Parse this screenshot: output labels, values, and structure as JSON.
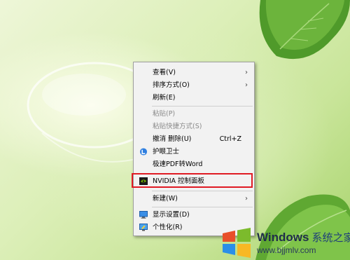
{
  "context_menu": {
    "view": {
      "label": "查看(V)"
    },
    "sort": {
      "label": "排序方式(O)"
    },
    "refresh": {
      "label": "刷新(E)"
    },
    "paste": {
      "label": "粘贴(P)"
    },
    "paste_shortcut": {
      "label": "粘贴快捷方式(S)"
    },
    "undo_delete": {
      "label": "撤消 删除(U)",
      "shortcut": "Ctrl+Z"
    },
    "eye_guard": {
      "label": "护眼卫士"
    },
    "pdf_to_word": {
      "label": "极速PDF转Word"
    },
    "nvidia": {
      "label": "NVIDIA 控制面板"
    },
    "new": {
      "label": "新建(W)"
    },
    "display": {
      "label": "显示设置(D)"
    },
    "personalize": {
      "label": "个性化(R)"
    }
  },
  "watermark": {
    "brand": "Windows",
    "brand_cn": "系统之家",
    "url": "www.bjjmlv.com"
  },
  "colors": {
    "highlight_border": "#e01b24",
    "menu_bg": "#f2f2f2",
    "nvidia_green": "#76b900"
  },
  "icons": [
    "chevron-right-icon",
    "eye-guard-icon",
    "nvidia-icon",
    "display-settings-icon",
    "personalize-icon",
    "windows-logo"
  ]
}
